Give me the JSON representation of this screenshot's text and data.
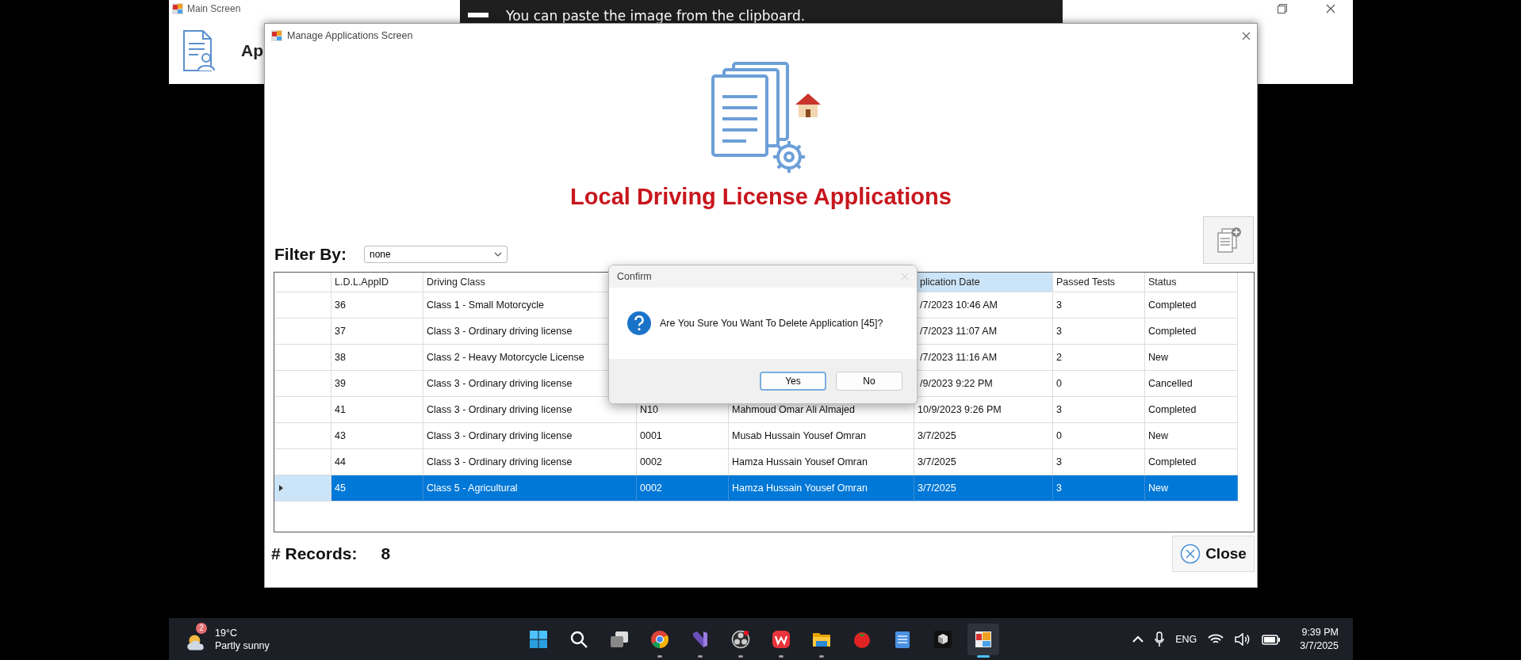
{
  "main_window": {
    "title": "Main Screen",
    "toolbar_label": "Ap"
  },
  "toast": {
    "message": "You can paste the image from the clipboard."
  },
  "manage_window": {
    "title": "Manage Applications Screen",
    "heading": "Local Driving License Applications",
    "filter": {
      "label": "Filter By:",
      "value": "none"
    },
    "table": {
      "columns": {
        "ldl_app_id": {
          "label": "L.D.L.AppID",
          "highlighted": false
        },
        "driving_class": {
          "label": "Driving Class",
          "highlighted": false
        },
        "application_date": {
          "label": "plication Date",
          "highlighted": true
        },
        "passed_tests": {
          "label": "Passed Tests",
          "highlighted": false
        },
        "status": {
          "label": "Status",
          "highlighted": false
        }
      },
      "rows": [
        {
          "ldl_app_id": "36",
          "driving_class": "Class 1 - Small Motorcycle",
          "application_date": "/7/2023 10:46 AM",
          "passed_tests": "3",
          "status": "Completed",
          "selected": false
        },
        {
          "ldl_app_id": "37",
          "driving_class": "Class 3 - Ordinary driving license",
          "application_date": "/7/2023 11:07 AM",
          "passed_tests": "3",
          "status": "Completed",
          "selected": false
        },
        {
          "ldl_app_id": "38",
          "driving_class": "Class 2 - Heavy Motorcycle License",
          "application_date": "/7/2023 11:16 AM",
          "passed_tests": "2",
          "status": "New",
          "selected": false
        },
        {
          "ldl_app_id": "39",
          "driving_class": "Class 3 - Ordinary driving license",
          "application_date": "/9/2023 9:22 PM",
          "passed_tests": "0",
          "status": "Cancelled",
          "selected": false
        },
        {
          "ldl_app_id": "41",
          "driving_class": "Class 3 - Ordinary driving license",
          "column_3": "N10",
          "column_4": "Mahmoud Omar Ali Almajed",
          "application_date": "10/9/2023 9:26 PM",
          "passed_tests": "3",
          "status": "Completed",
          "selected": false
        },
        {
          "ldl_app_id": "43",
          "driving_class": "Class 3 - Ordinary driving license",
          "column_3": "0001",
          "column_4": "Musab Hussain  Yousef Omran",
          "application_date": "3/7/2025",
          "passed_tests": "0",
          "status": "New",
          "selected": false
        },
        {
          "ldl_app_id": "44",
          "driving_class": "Class 3 - Ordinary driving license",
          "column_3": "0002",
          "column_4": "Hamza Hussain  Yousef Omran",
          "application_date": "3/7/2025",
          "passed_tests": "3",
          "status": "Completed",
          "selected": false
        },
        {
          "ldl_app_id": "45",
          "driving_class": "Class 5 - Agricultural",
          "column_3": "0002",
          "column_4": "Hamza Hussain  Yousef Omran",
          "application_date": "3/7/2025",
          "passed_tests": "3",
          "status": "New",
          "selected": true
        }
      ]
    },
    "records_label": "# Records:",
    "records_count": "8",
    "close_button": "Close"
  },
  "confirm_dialog": {
    "title": "Confirm",
    "message": "Are You Sure You Want To Delete Application [45]?",
    "buttons": [
      {
        "label": "Yes",
        "focused": true
      },
      {
        "label": "No",
        "focused": false
      }
    ]
  },
  "taskbar": {
    "weather": {
      "badge": "2",
      "temperature": "19°C",
      "condition": "Partly sunny"
    },
    "apps": [
      {
        "kind": "start",
        "running": false,
        "active": false
      },
      {
        "kind": "search",
        "running": false,
        "active": false
      },
      {
        "kind": "task-view",
        "running": false,
        "active": false
      },
      {
        "kind": "browser",
        "running": true,
        "active": false
      },
      {
        "kind": "ide",
        "running": true,
        "active": false
      },
      {
        "kind": "recorder",
        "running": true,
        "active": false
      },
      {
        "kind": "office",
        "running": true,
        "active": false
      },
      {
        "kind": "folder",
        "running": true,
        "active": false
      },
      {
        "kind": "tomato",
        "running": false,
        "active": false
      },
      {
        "kind": "notepad",
        "running": false,
        "active": false
      },
      {
        "kind": "cube",
        "running": false,
        "active": false
      },
      {
        "kind": "winform",
        "running": true,
        "active": true
      }
    ],
    "language": "ENG",
    "time": "9:39 PM",
    "date": "3/7/2025"
  }
}
